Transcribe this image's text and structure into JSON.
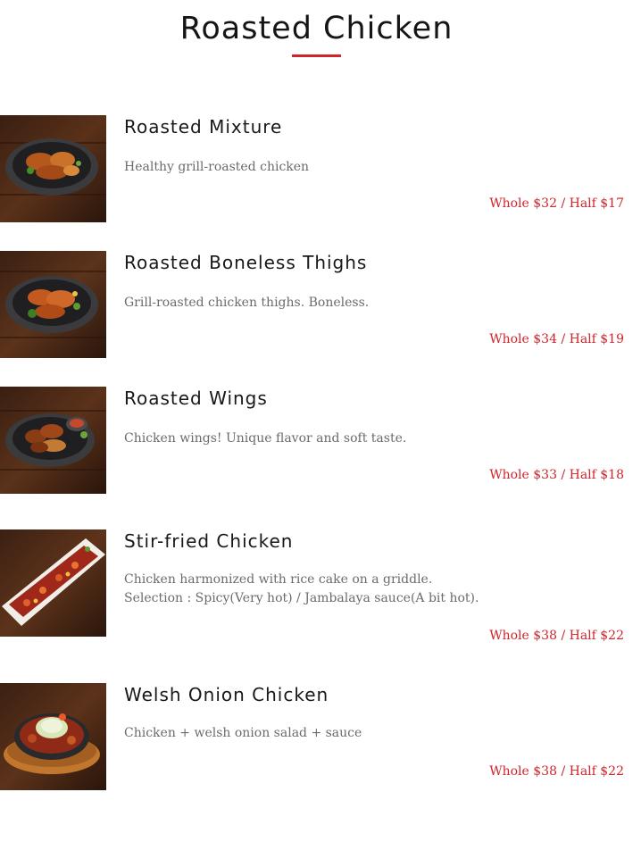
{
  "section": {
    "title": "Roasted Chicken",
    "accent_color": "#d1232a"
  },
  "items": [
    {
      "name": "Roasted Mixture",
      "description": "Healthy grill-roasted chicken",
      "price": "Whole $32 / Half $17",
      "image": "roasted-mixture-photo"
    },
    {
      "name": "Roasted Boneless Thighs",
      "description": "Grill-roasted chicken thighs. Boneless.",
      "price": "Whole $34 / Half $19",
      "image": "roasted-boneless-thighs-photo"
    },
    {
      "name": "Roasted Wings",
      "description": "Chicken wings! Unique flavor and soft taste.",
      "price": "Whole $33 / Half $18",
      "image": "roasted-wings-photo"
    },
    {
      "name": "Stir-fried Chicken",
      "description": "Chicken harmonized with rice cake on a griddle. Selection : Spicy(Very hot) / Jambalaya sauce(A bit hot).",
      "price": "Whole $38 / Half $22",
      "image": "stir-fried-chicken-photo"
    },
    {
      "name": "Welsh Onion Chicken",
      "description": "Chicken + welsh onion salad + sauce",
      "price": "Whole $38 / Half $22",
      "image": "welsh-onion-chicken-photo"
    }
  ]
}
